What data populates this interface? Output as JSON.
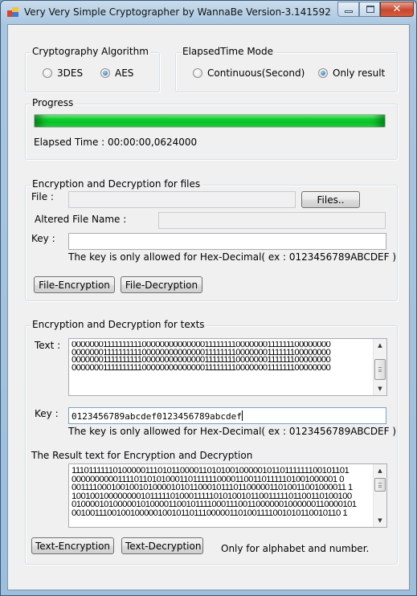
{
  "window": {
    "title": "Very Very Simple Cryptographer by WannaBe Version-3.141592",
    "controls": {
      "minimize": "minimize",
      "maximize": "maximize",
      "close": "✕"
    }
  },
  "algorithm": {
    "legend": "Cryptography Algorithm",
    "options": [
      {
        "label": "3DES",
        "selected": false
      },
      {
        "label": "AES",
        "selected": true
      }
    ]
  },
  "elapsed_mode": {
    "legend": "ElapsedTime Mode",
    "options": [
      {
        "label": "Continuous(Second)",
        "selected": false
      },
      {
        "label": "Only result",
        "selected": true
      }
    ]
  },
  "progress": {
    "legend": "Progress",
    "percent": 100,
    "elapsed_label": "Elapsed Time : 00:00:00,0624000",
    "fill_color": "#0ac82a"
  },
  "files": {
    "legend": "Encryption and Decryption for files",
    "file_label": "File :",
    "file_value": "",
    "browse_button": "Files..",
    "altered_label": "Altered File Name :",
    "altered_value": "",
    "key_label": "Key :",
    "key_value": "",
    "key_hint": "The key is only allowed for Hex-Decimal( ex : 0123456789ABCDEF )",
    "encrypt_button": "File-Encryption",
    "decrypt_button": "File-Decryption"
  },
  "texts": {
    "legend": "Encryption and Decryption for texts",
    "text_label": "Text :",
    "text_value": "0000000111111111100000000000000111111110000000111111100000000\n0000000111111111100000000000000111111110000000111111100000000\n0000000111111111100000000000000111111110000000111111100000000\n0000000111111111100000000000000111111110000000111111100000000",
    "key_label": "Key :",
    "key_value": "0123456789abcdef0123456789abcdef",
    "key_hint": "The key is only allowed for Hex-Decimal( ex : 0123456789ABCDEF )",
    "result_label": "The Result text for Encryption and Decryption",
    "result_value": "111011111101000001110101100001101010010000010110111111100101101\n000000000011110110101000110111111000011001101111101001000001 0\n0011110001001001010000101011000101110110000011010011001000011 1\n100100100000000101111101000111110101001011001111101100110100100\n010000101000001010000110010111100011100110000001000000110000101\n001001110010010000010010110111000001101001111001010110010110 1",
    "encrypt_button": "Text-Encryption",
    "decrypt_button": "Text-Decryption",
    "note": "Only for alphabet and number."
  }
}
